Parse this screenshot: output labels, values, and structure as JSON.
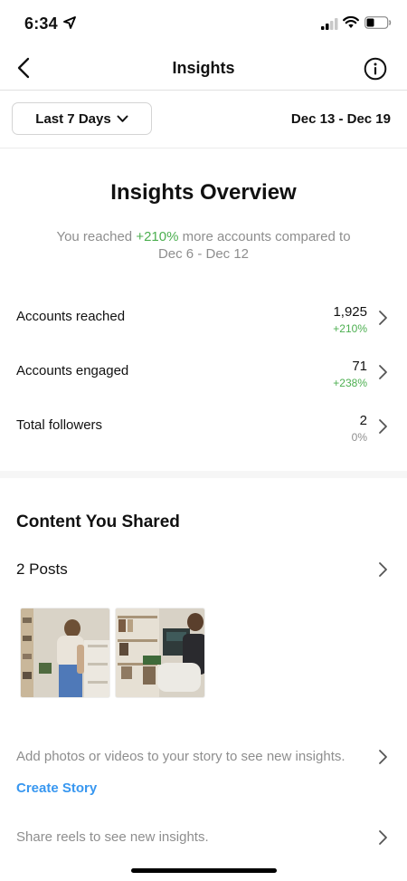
{
  "status": {
    "time": "6:34"
  },
  "header": {
    "title": "Insights"
  },
  "filter": {
    "range_label": "Last 7 Days",
    "date_range": "Dec 13 - Dec 19"
  },
  "overview": {
    "title": "Insights Overview",
    "subtitle_pre": "You reached ",
    "subtitle_change": "+210%",
    "subtitle_post": " more accounts compared to",
    "subtitle_dates": "Dec 6 - Dec 12",
    "metrics": [
      {
        "label": "Accounts reached",
        "value": "1,925",
        "change": "+210%",
        "change_color": "#4caf50"
      },
      {
        "label": "Accounts engaged",
        "value": "71",
        "change": "+238%",
        "change_color": "#4caf50"
      },
      {
        "label": "Total followers",
        "value": "2",
        "change": "0%",
        "change_color": "#8e8e8e"
      }
    ]
  },
  "content": {
    "title": "Content You Shared",
    "posts_label": "2 Posts",
    "story_prompt": "Add photos or videos to your story to see new insights.",
    "create_story": "Create Story",
    "reels_prompt": "Share reels to see new insights."
  },
  "colors": {
    "accent": "#3897f0",
    "positive": "#4caf50",
    "muted": "#8e8e8e"
  }
}
